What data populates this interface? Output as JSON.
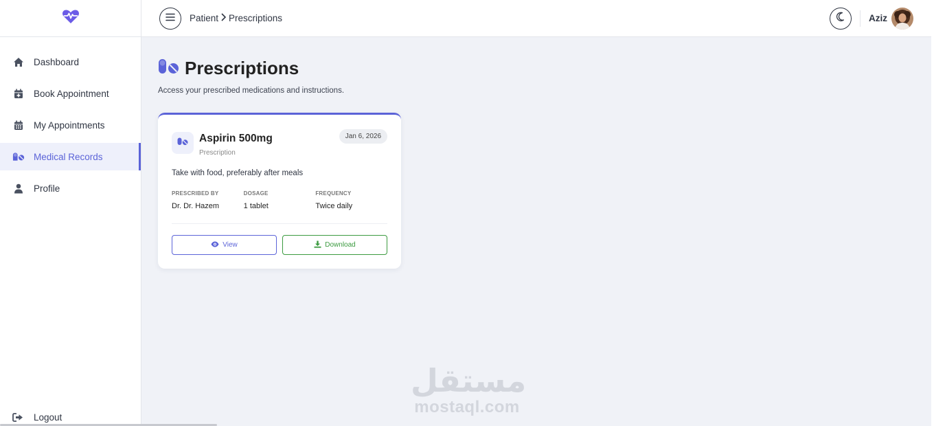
{
  "sidebar": {
    "items": [
      {
        "label": "Dashboard",
        "icon": "home-icon"
      },
      {
        "label": "Book Appointment",
        "icon": "calendar-plus-icon"
      },
      {
        "label": "My Appointments",
        "icon": "calendar-icon"
      },
      {
        "label": "Medical Records",
        "icon": "pills-icon",
        "active": true
      },
      {
        "label": "Profile",
        "icon": "user-icon"
      }
    ],
    "logout_label": "Logout"
  },
  "header": {
    "breadcrumb": [
      "Patient",
      "Prescriptions"
    ],
    "username": "Aziz"
  },
  "page": {
    "title": "Prescriptions",
    "subtitle": "Access your prescribed medications and instructions."
  },
  "prescription": {
    "name": "Aspirin 500mg",
    "type": "Prescription",
    "date": "Jan 6, 2026",
    "instructions": "Take with food, preferably after meals",
    "details": [
      {
        "label": "PRESCRIBED BY",
        "value": "Dr. Dr. Hazem"
      },
      {
        "label": "DOSAGE",
        "value": "1 tablet"
      },
      {
        "label": "FREQUENCY",
        "value": "Twice daily"
      }
    ],
    "view_label": "View",
    "download_label": "Download"
  },
  "watermark": {
    "arabic": "مستقل",
    "latin": "mostaql.com"
  },
  "colors": {
    "accent": "#5b63d8",
    "success": "#3b9a3f",
    "background": "#f0f2f7"
  }
}
